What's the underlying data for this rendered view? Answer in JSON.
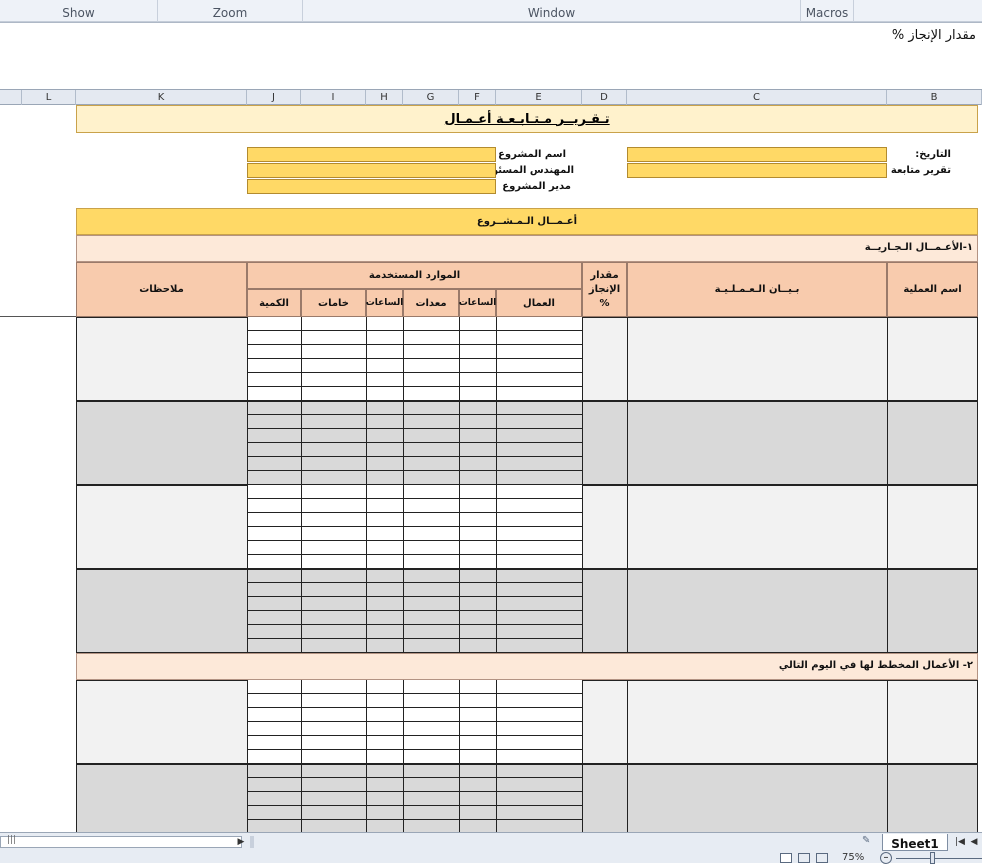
{
  "ribbon": {
    "groups": [
      "Show",
      "Zoom",
      "Window",
      "Macros"
    ]
  },
  "formula_bar": {
    "text": "مقدار الإنجاز %"
  },
  "columns": [
    "L",
    "K",
    "J",
    "I",
    "H",
    "G",
    "F",
    "E",
    "D",
    "C",
    "B"
  ],
  "report": {
    "title": "تـقـريــر مـتـابـعـة أعـمـال",
    "right_labels": [
      "التاريخ:",
      "تقرير متابعة رقم"
    ],
    "mid_labels": [
      "اسم المشروع",
      "المهندس المسئول",
      "مدير المشروع"
    ],
    "works_header": "أعـمــال الـمـشــروع",
    "section1": "١-الأعـمــال الـجـاريــة",
    "section2": "٢- الأعمال المخطط لها في اليوم التالي",
    "headers": {
      "op_name": "اسم العملية",
      "op_desc": "بـيــان الـعـمـلـيـة",
      "progress": "مقدار الإنجاز %",
      "resources": "الموارد المستخدمة",
      "notes": "ملاحظات",
      "workers": "العمال",
      "hours1": "الساعات",
      "equipment": "معدات",
      "hours2": "الساعات",
      "materials": "خامات",
      "quantity": "الكمية"
    }
  },
  "bottom": {
    "sheet_tab": "Sheet1",
    "zoom": "75%"
  },
  "colors": {
    "title_fill": "#fff2cc",
    "header_fill": "#ffd966",
    "col_header_fill": "#f8cbad",
    "section_fill": "#fde9d9",
    "shaded_row": "#d9d9d9"
  }
}
